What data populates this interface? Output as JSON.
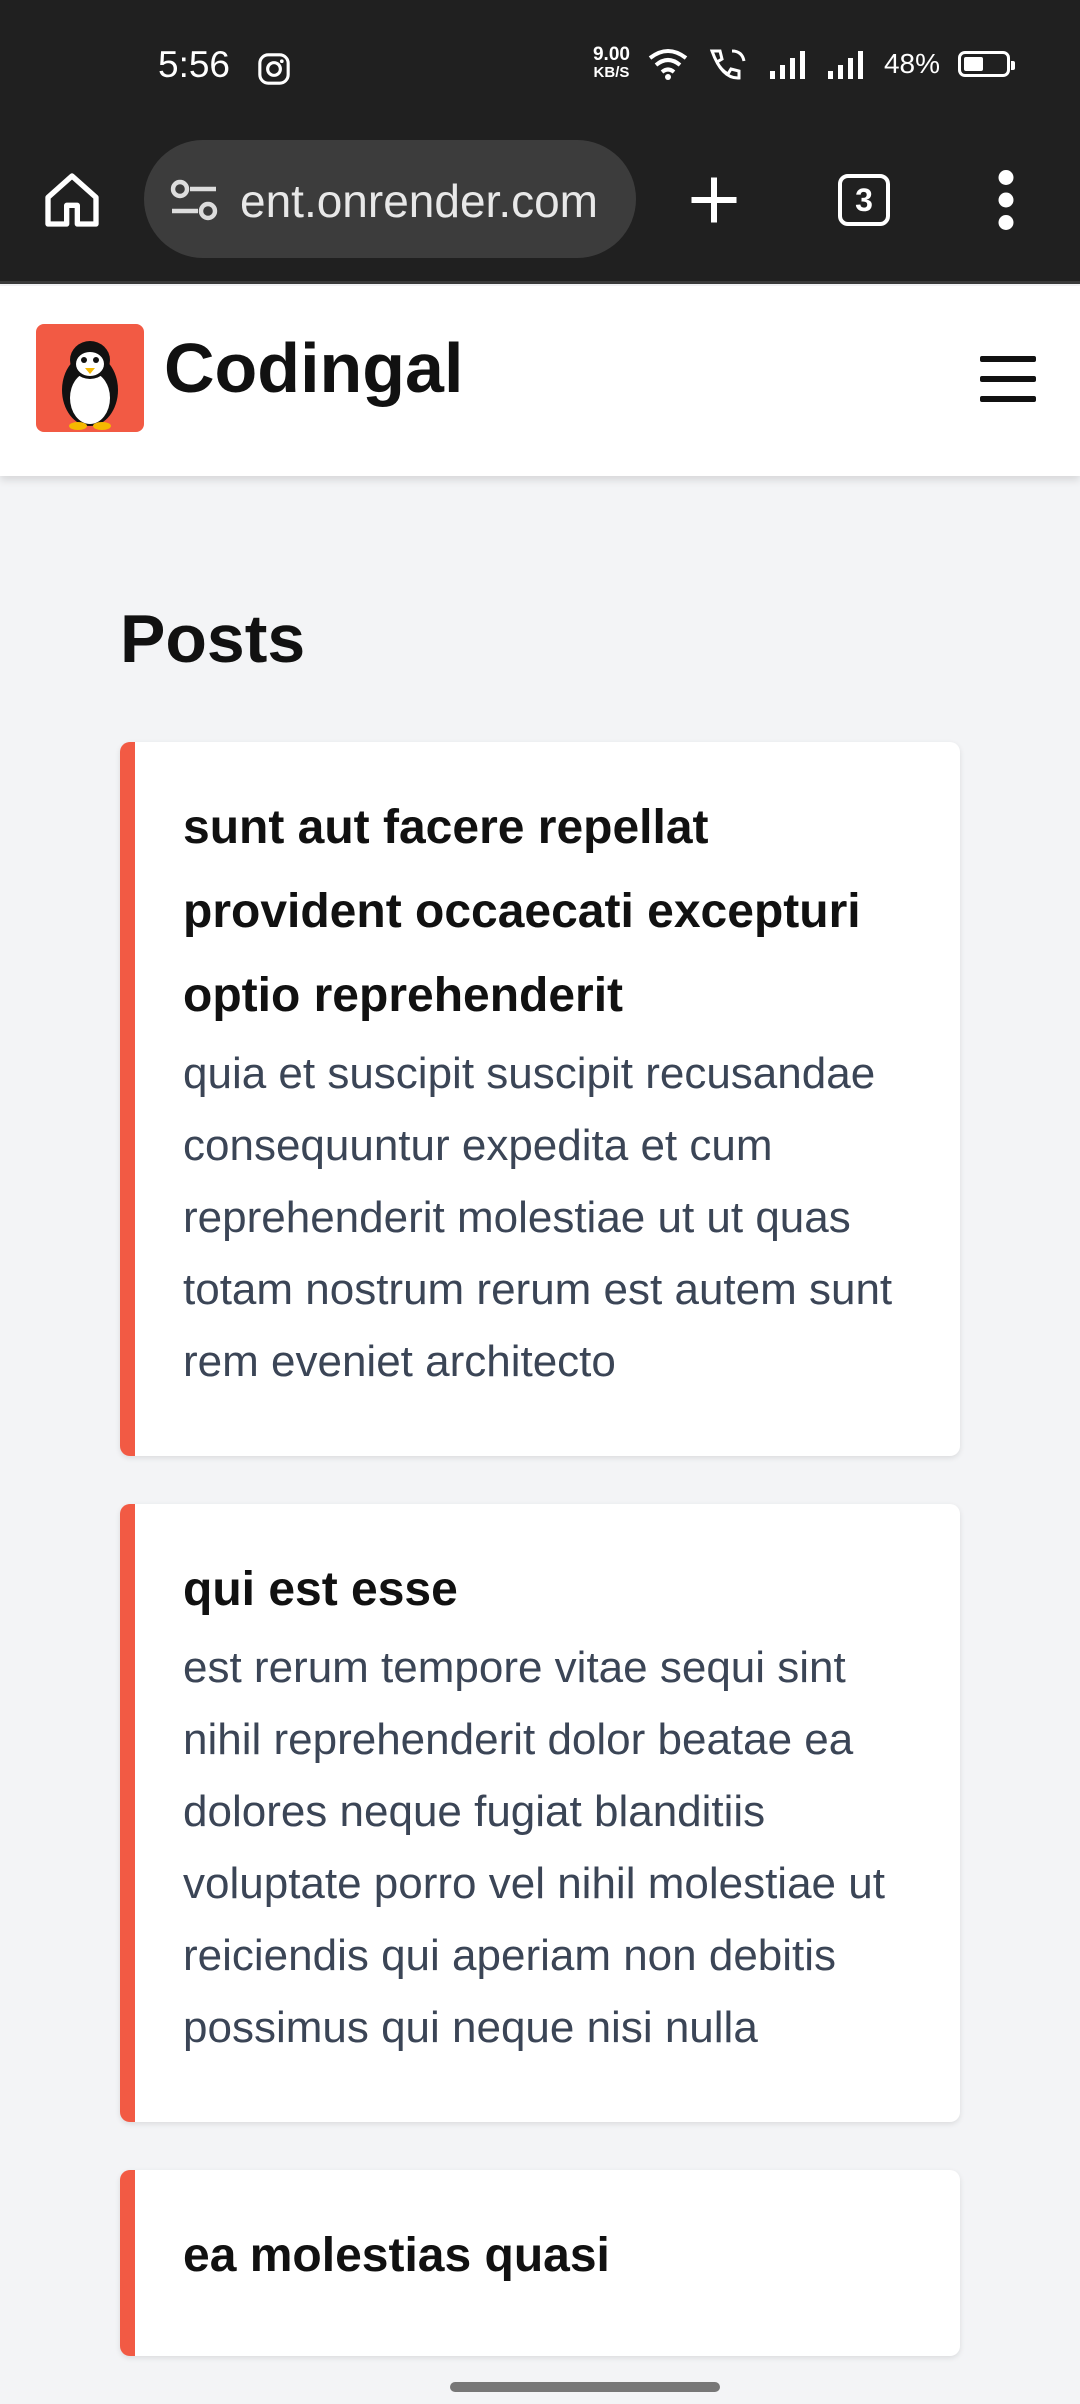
{
  "status_bar": {
    "time": "5:56",
    "net_speed_value": "9.00",
    "net_speed_unit": "KB/S",
    "battery_percent": "48%",
    "battery_level": 0.48
  },
  "browser": {
    "url": "ent.onrender.com",
    "tab_count": "3"
  },
  "site": {
    "brand": "Codingal",
    "accent_color": "#f25a44"
  },
  "page": {
    "title": "Posts"
  },
  "posts": [
    {
      "title": "sunt aut facere repellat provident occaecati excepturi optio reprehenderit",
      "body": "quia et suscipit suscipit recusandae consequuntur expedita et cum reprehenderit molestiae ut ut quas totam nostrum rerum est autem sunt rem eveniet architecto"
    },
    {
      "title": "qui est esse",
      "body": "est rerum tempore vitae sequi sint nihil reprehenderit dolor beatae ea dolores neque fugiat blanditiis voluptate porro vel nihil molestiae ut reiciendis qui aperiam non debitis possimus qui neque nisi nulla"
    },
    {
      "title": "ea molestias quasi",
      "body": ""
    }
  ]
}
